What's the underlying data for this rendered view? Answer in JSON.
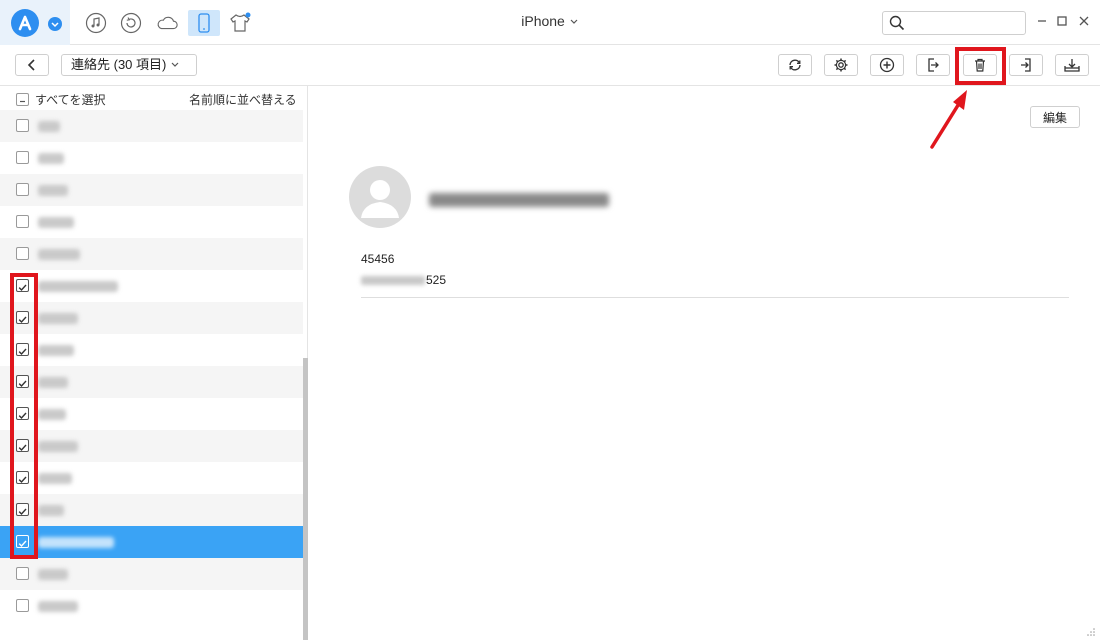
{
  "window": {
    "title": "iPhone",
    "search": {
      "placeholder": "",
      "value": ""
    }
  },
  "nav_icons": [
    "music-icon",
    "restore-icon",
    "cloud-icon",
    "phone-icon",
    "tshirt-icon"
  ],
  "toolbar": {
    "category_label": "連絡先 (30 項目)",
    "buttons": [
      "refresh-icon",
      "settings-icon",
      "add-icon",
      "export-icon",
      "delete-icon",
      "import-icon",
      "download-icon"
    ]
  },
  "list": {
    "select_all_label": "すべてを選択",
    "sort_label": "名前順に並べ替える",
    "rows": [
      {
        "checked": false,
        "selected": false
      },
      {
        "checked": false,
        "selected": false
      },
      {
        "checked": false,
        "selected": false
      },
      {
        "checked": false,
        "selected": false
      },
      {
        "checked": false,
        "selected": false
      },
      {
        "checked": true,
        "selected": false
      },
      {
        "checked": true,
        "selected": false
      },
      {
        "checked": true,
        "selected": false
      },
      {
        "checked": true,
        "selected": false
      },
      {
        "checked": true,
        "selected": false
      },
      {
        "checked": true,
        "selected": false
      },
      {
        "checked": true,
        "selected": false
      },
      {
        "checked": true,
        "selected": false
      },
      {
        "checked": true,
        "selected": true
      },
      {
        "checked": false,
        "selected": false
      },
      {
        "checked": false,
        "selected": false
      }
    ]
  },
  "detail": {
    "edit_label": "編集",
    "phone1": "45456",
    "phone2_visible": "525"
  },
  "colors": {
    "accent": "#3aa3f5",
    "annotation": "#e0161d",
    "logo": "#2d8ef0"
  }
}
